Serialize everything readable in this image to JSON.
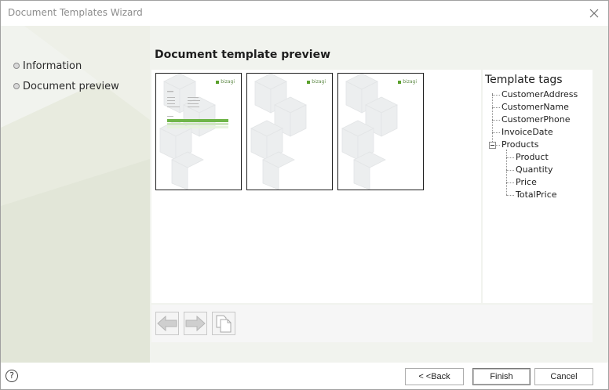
{
  "window": {
    "title": "Document Templates Wizard"
  },
  "nav": {
    "items": [
      {
        "label": "Information"
      },
      {
        "label": "Document preview"
      }
    ]
  },
  "main": {
    "title": "Document template preview"
  },
  "preview": {
    "pages": [
      {
        "logo": "bizagi"
      },
      {
        "logo": "bizagi"
      },
      {
        "logo": "bizagi"
      }
    ]
  },
  "tags": {
    "title": "Template tags",
    "items": [
      {
        "label": "CustomerAddress"
      },
      {
        "label": "CustomerName"
      },
      {
        "label": "CustomerPhone"
      },
      {
        "label": "InvoiceDate"
      },
      {
        "label": "Products",
        "children": [
          {
            "label": "Product"
          },
          {
            "label": "Quantity"
          },
          {
            "label": "Price"
          },
          {
            "label": "TotalPrice"
          }
        ]
      }
    ]
  },
  "toolbar": {
    "prev_icon": "arrow-left-icon",
    "next_icon": "arrow-right-icon",
    "copy_icon": "copy-icon"
  },
  "footer": {
    "help_label": "?",
    "back_label": "< <Back",
    "finish_label": "Finish",
    "cancel_label": "Cancel"
  }
}
